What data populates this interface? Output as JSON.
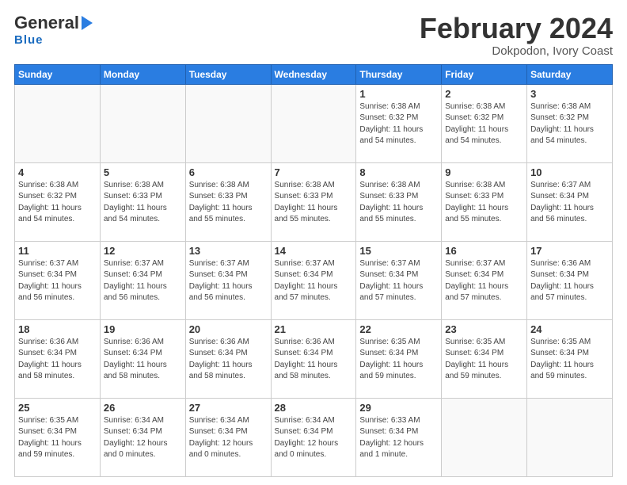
{
  "header": {
    "logo_general": "General",
    "logo_blue": "Blue",
    "month_title": "February 2024",
    "location": "Dokpodon, Ivory Coast"
  },
  "weekdays": [
    "Sunday",
    "Monday",
    "Tuesday",
    "Wednesday",
    "Thursday",
    "Friday",
    "Saturday"
  ],
  "weeks": [
    [
      {
        "day": "",
        "info": ""
      },
      {
        "day": "",
        "info": ""
      },
      {
        "day": "",
        "info": ""
      },
      {
        "day": "",
        "info": ""
      },
      {
        "day": "1",
        "info": "Sunrise: 6:38 AM\nSunset: 6:32 PM\nDaylight: 11 hours\nand 54 minutes."
      },
      {
        "day": "2",
        "info": "Sunrise: 6:38 AM\nSunset: 6:32 PM\nDaylight: 11 hours\nand 54 minutes."
      },
      {
        "day": "3",
        "info": "Sunrise: 6:38 AM\nSunset: 6:32 PM\nDaylight: 11 hours\nand 54 minutes."
      }
    ],
    [
      {
        "day": "4",
        "info": "Sunrise: 6:38 AM\nSunset: 6:32 PM\nDaylight: 11 hours\nand 54 minutes."
      },
      {
        "day": "5",
        "info": "Sunrise: 6:38 AM\nSunset: 6:33 PM\nDaylight: 11 hours\nand 54 minutes."
      },
      {
        "day": "6",
        "info": "Sunrise: 6:38 AM\nSunset: 6:33 PM\nDaylight: 11 hours\nand 55 minutes."
      },
      {
        "day": "7",
        "info": "Sunrise: 6:38 AM\nSunset: 6:33 PM\nDaylight: 11 hours\nand 55 minutes."
      },
      {
        "day": "8",
        "info": "Sunrise: 6:38 AM\nSunset: 6:33 PM\nDaylight: 11 hours\nand 55 minutes."
      },
      {
        "day": "9",
        "info": "Sunrise: 6:38 AM\nSunset: 6:33 PM\nDaylight: 11 hours\nand 55 minutes."
      },
      {
        "day": "10",
        "info": "Sunrise: 6:37 AM\nSunset: 6:34 PM\nDaylight: 11 hours\nand 56 minutes."
      }
    ],
    [
      {
        "day": "11",
        "info": "Sunrise: 6:37 AM\nSunset: 6:34 PM\nDaylight: 11 hours\nand 56 minutes."
      },
      {
        "day": "12",
        "info": "Sunrise: 6:37 AM\nSunset: 6:34 PM\nDaylight: 11 hours\nand 56 minutes."
      },
      {
        "day": "13",
        "info": "Sunrise: 6:37 AM\nSunset: 6:34 PM\nDaylight: 11 hours\nand 56 minutes."
      },
      {
        "day": "14",
        "info": "Sunrise: 6:37 AM\nSunset: 6:34 PM\nDaylight: 11 hours\nand 57 minutes."
      },
      {
        "day": "15",
        "info": "Sunrise: 6:37 AM\nSunset: 6:34 PM\nDaylight: 11 hours\nand 57 minutes."
      },
      {
        "day": "16",
        "info": "Sunrise: 6:37 AM\nSunset: 6:34 PM\nDaylight: 11 hours\nand 57 minutes."
      },
      {
        "day": "17",
        "info": "Sunrise: 6:36 AM\nSunset: 6:34 PM\nDaylight: 11 hours\nand 57 minutes."
      }
    ],
    [
      {
        "day": "18",
        "info": "Sunrise: 6:36 AM\nSunset: 6:34 PM\nDaylight: 11 hours\nand 58 minutes."
      },
      {
        "day": "19",
        "info": "Sunrise: 6:36 AM\nSunset: 6:34 PM\nDaylight: 11 hours\nand 58 minutes."
      },
      {
        "day": "20",
        "info": "Sunrise: 6:36 AM\nSunset: 6:34 PM\nDaylight: 11 hours\nand 58 minutes."
      },
      {
        "day": "21",
        "info": "Sunrise: 6:36 AM\nSunset: 6:34 PM\nDaylight: 11 hours\nand 58 minutes."
      },
      {
        "day": "22",
        "info": "Sunrise: 6:35 AM\nSunset: 6:34 PM\nDaylight: 11 hours\nand 59 minutes."
      },
      {
        "day": "23",
        "info": "Sunrise: 6:35 AM\nSunset: 6:34 PM\nDaylight: 11 hours\nand 59 minutes."
      },
      {
        "day": "24",
        "info": "Sunrise: 6:35 AM\nSunset: 6:34 PM\nDaylight: 11 hours\nand 59 minutes."
      }
    ],
    [
      {
        "day": "25",
        "info": "Sunrise: 6:35 AM\nSunset: 6:34 PM\nDaylight: 11 hours\nand 59 minutes."
      },
      {
        "day": "26",
        "info": "Sunrise: 6:34 AM\nSunset: 6:34 PM\nDaylight: 12 hours\nand 0 minutes."
      },
      {
        "day": "27",
        "info": "Sunrise: 6:34 AM\nSunset: 6:34 PM\nDaylight: 12 hours\nand 0 minutes."
      },
      {
        "day": "28",
        "info": "Sunrise: 6:34 AM\nSunset: 6:34 PM\nDaylight: 12 hours\nand 0 minutes."
      },
      {
        "day": "29",
        "info": "Sunrise: 6:33 AM\nSunset: 6:34 PM\nDaylight: 12 hours\nand 1 minute."
      },
      {
        "day": "",
        "info": ""
      },
      {
        "day": "",
        "info": ""
      }
    ]
  ]
}
